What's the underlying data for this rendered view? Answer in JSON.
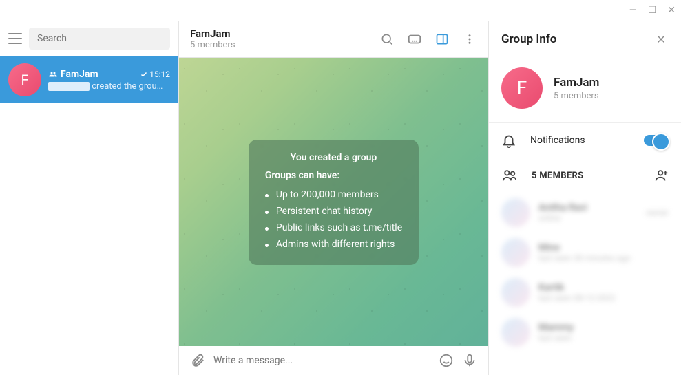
{
  "titlebar": {
    "min": "—",
    "max": "☐",
    "close": "✕"
  },
  "sidebar": {
    "search_placeholder": "Search",
    "chat": {
      "name": "FamJam",
      "time": "15:12",
      "preview": "created the grou…"
    }
  },
  "header": {
    "title": "FamJam",
    "subtitle": "5 members"
  },
  "info_card": {
    "title": "You created a group",
    "subtitle": "Groups can have:",
    "items": [
      "Up to 200,000 members",
      "Persistent chat history",
      "Public links such as t.me/title",
      "Admins with different rights"
    ]
  },
  "composer": {
    "placeholder": "Write a message..."
  },
  "panel": {
    "title": "Group Info",
    "group_name": "FamJam",
    "group_sub": "5 members",
    "notifications_label": "Notifications",
    "members_label": "5 MEMBERS",
    "members": [
      {
        "name": "Anitha Ravi",
        "status": "online",
        "role": "owner"
      },
      {
        "name": "Mine",
        "status": "last seen 30 minutes ago",
        "role": ""
      },
      {
        "name": "Kartik",
        "status": "last seen 08-12-2022",
        "role": ""
      },
      {
        "name": "Mammy",
        "status": "last seen",
        "role": ""
      }
    ]
  },
  "avatar_letter": "F"
}
